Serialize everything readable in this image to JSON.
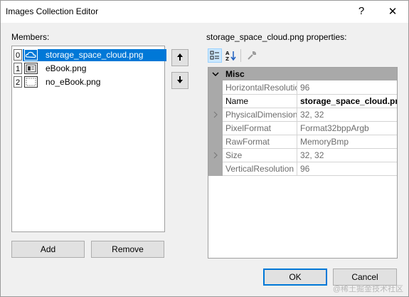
{
  "window": {
    "title": "Images Collection Editor",
    "help_glyph": "?",
    "close_glyph": "✕"
  },
  "members": {
    "label": "Members:",
    "items": [
      {
        "index": "0",
        "name": "storage_space_cloud.png",
        "selected": true
      },
      {
        "index": "1",
        "name": "eBook.png",
        "selected": false
      },
      {
        "index": "2",
        "name": "no_eBook.png",
        "selected": false
      }
    ],
    "move_up_icon": "arrow-up-icon",
    "move_down_icon": "arrow-down-icon"
  },
  "buttons": {
    "add": "Add",
    "remove": "Remove",
    "ok": "OK",
    "cancel": "Cancel"
  },
  "properties": {
    "label": "storage_space_cloud.png properties:",
    "toolbar": [
      "categorized-icon",
      "alphabetical-icon",
      "property-pages-icon"
    ],
    "category": "Misc",
    "rows": [
      {
        "name": "HorizontalResolution",
        "value": "96",
        "expandable": false,
        "active": false
      },
      {
        "name": "Name",
        "value": "storage_space_cloud.png",
        "expandable": false,
        "active": true
      },
      {
        "name": "PhysicalDimension",
        "value": "32, 32",
        "expandable": true,
        "active": false
      },
      {
        "name": "PixelFormat",
        "value": "Format32bppArgb",
        "expandable": false,
        "active": false
      },
      {
        "name": "RawFormat",
        "value": "MemoryBmp",
        "expandable": false,
        "active": false
      },
      {
        "name": "Size",
        "value": "32, 32",
        "expandable": true,
        "active": false
      },
      {
        "name": "VerticalResolution",
        "value": "96",
        "expandable": false,
        "active": false
      }
    ]
  },
  "watermark": "@稀土掘金技术社区",
  "colors": {
    "selection": "#0078d7",
    "gutter": "#a9a9a9"
  }
}
